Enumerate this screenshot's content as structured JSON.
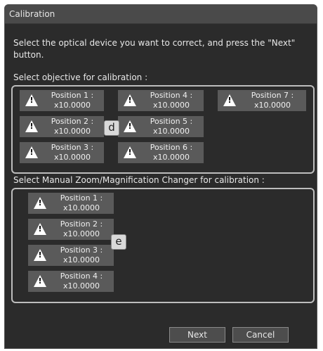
{
  "window": {
    "title": "Calibration",
    "instruction": "Select the optical device you want to correct, and press the \"Next\" button."
  },
  "objective": {
    "label": "Select objective for calibration :",
    "positions": [
      {
        "name": "Position 1 :",
        "value": "x10.0000"
      },
      {
        "name": "Position 2 :",
        "value": "x10.0000"
      },
      {
        "name": "Position 3 :",
        "value": "x10.0000"
      },
      {
        "name": "Position 4 :",
        "value": "x10.0000"
      },
      {
        "name": "Position 5 :",
        "value": "x10.0000"
      },
      {
        "name": "Position 6 :",
        "value": "x10.0000"
      },
      {
        "name": "Position 7 :",
        "value": "x10.0000"
      }
    ],
    "callout": "d"
  },
  "zoom": {
    "label": "Select Manual Zoom/Magnification Changer for calibration :",
    "positions": [
      {
        "name": "Position 1 :",
        "value": "x10.0000"
      },
      {
        "name": "Position 2 :",
        "value": "x10.0000"
      },
      {
        "name": "Position 3 :",
        "value": "x10.0000"
      },
      {
        "name": "Position 4 :",
        "value": "x10.0000"
      }
    ],
    "callout": "e"
  },
  "buttons": {
    "next": "Next",
    "cancel": "Cancel"
  },
  "icons": {
    "warning": "warning-triangle-icon"
  }
}
